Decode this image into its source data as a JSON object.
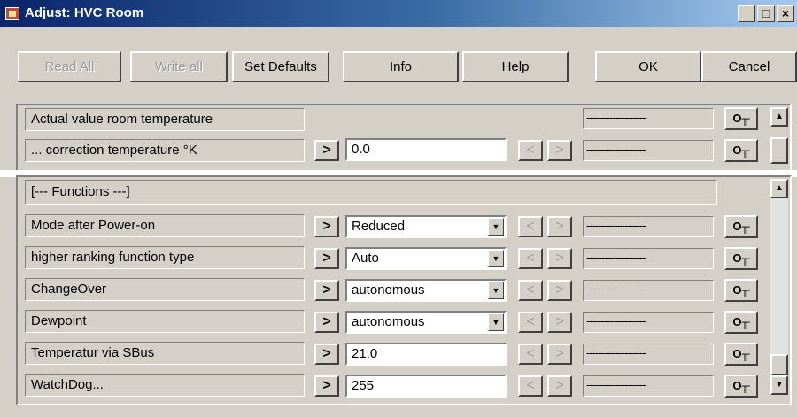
{
  "window": {
    "title": "Adjust: HVC Room",
    "controls": {
      "minimize": "_",
      "maximize": "□",
      "close": "×"
    }
  },
  "toolbar": {
    "read_all": "Read All",
    "write_all": "Write all",
    "set_defaults": "Set Defaults",
    "info": "Info",
    "help": "Help",
    "ok": "OK",
    "cancel": "Cancel"
  },
  "glyphs": {
    "next": ">",
    "prev": "<",
    "key": "O╥",
    "dropdown": "▼",
    "scroll_up": "▲",
    "scroll_down": "▼"
  },
  "upper": {
    "rows": [
      {
        "label": "Actual value room temperature",
        "value": "",
        "status": "--------------------"
      },
      {
        "label": "... correction temperature °K",
        "value": "0.0",
        "status": "--------------------"
      }
    ]
  },
  "functions": {
    "header": "[--- Functions ---]",
    "rows": [
      {
        "label": "Mode after Power-on",
        "value": "Reduced",
        "type": "dropdown",
        "status": "--------------------"
      },
      {
        "label": "higher ranking function type",
        "value": "Auto",
        "type": "dropdown",
        "status": "--------------------"
      },
      {
        "label": "ChangeOver",
        "value": "autonomous",
        "type": "dropdown",
        "status": "--------------------"
      },
      {
        "label": "Dewpoint",
        "value": "autonomous",
        "type": "dropdown",
        "status": "--------------------"
      },
      {
        "label": "Temperatur via SBus",
        "value": "21.0",
        "type": "text",
        "status": "--------------------"
      },
      {
        "label": "WatchDog...",
        "value": "255",
        "type": "text",
        "status": "--------------------"
      }
    ]
  }
}
